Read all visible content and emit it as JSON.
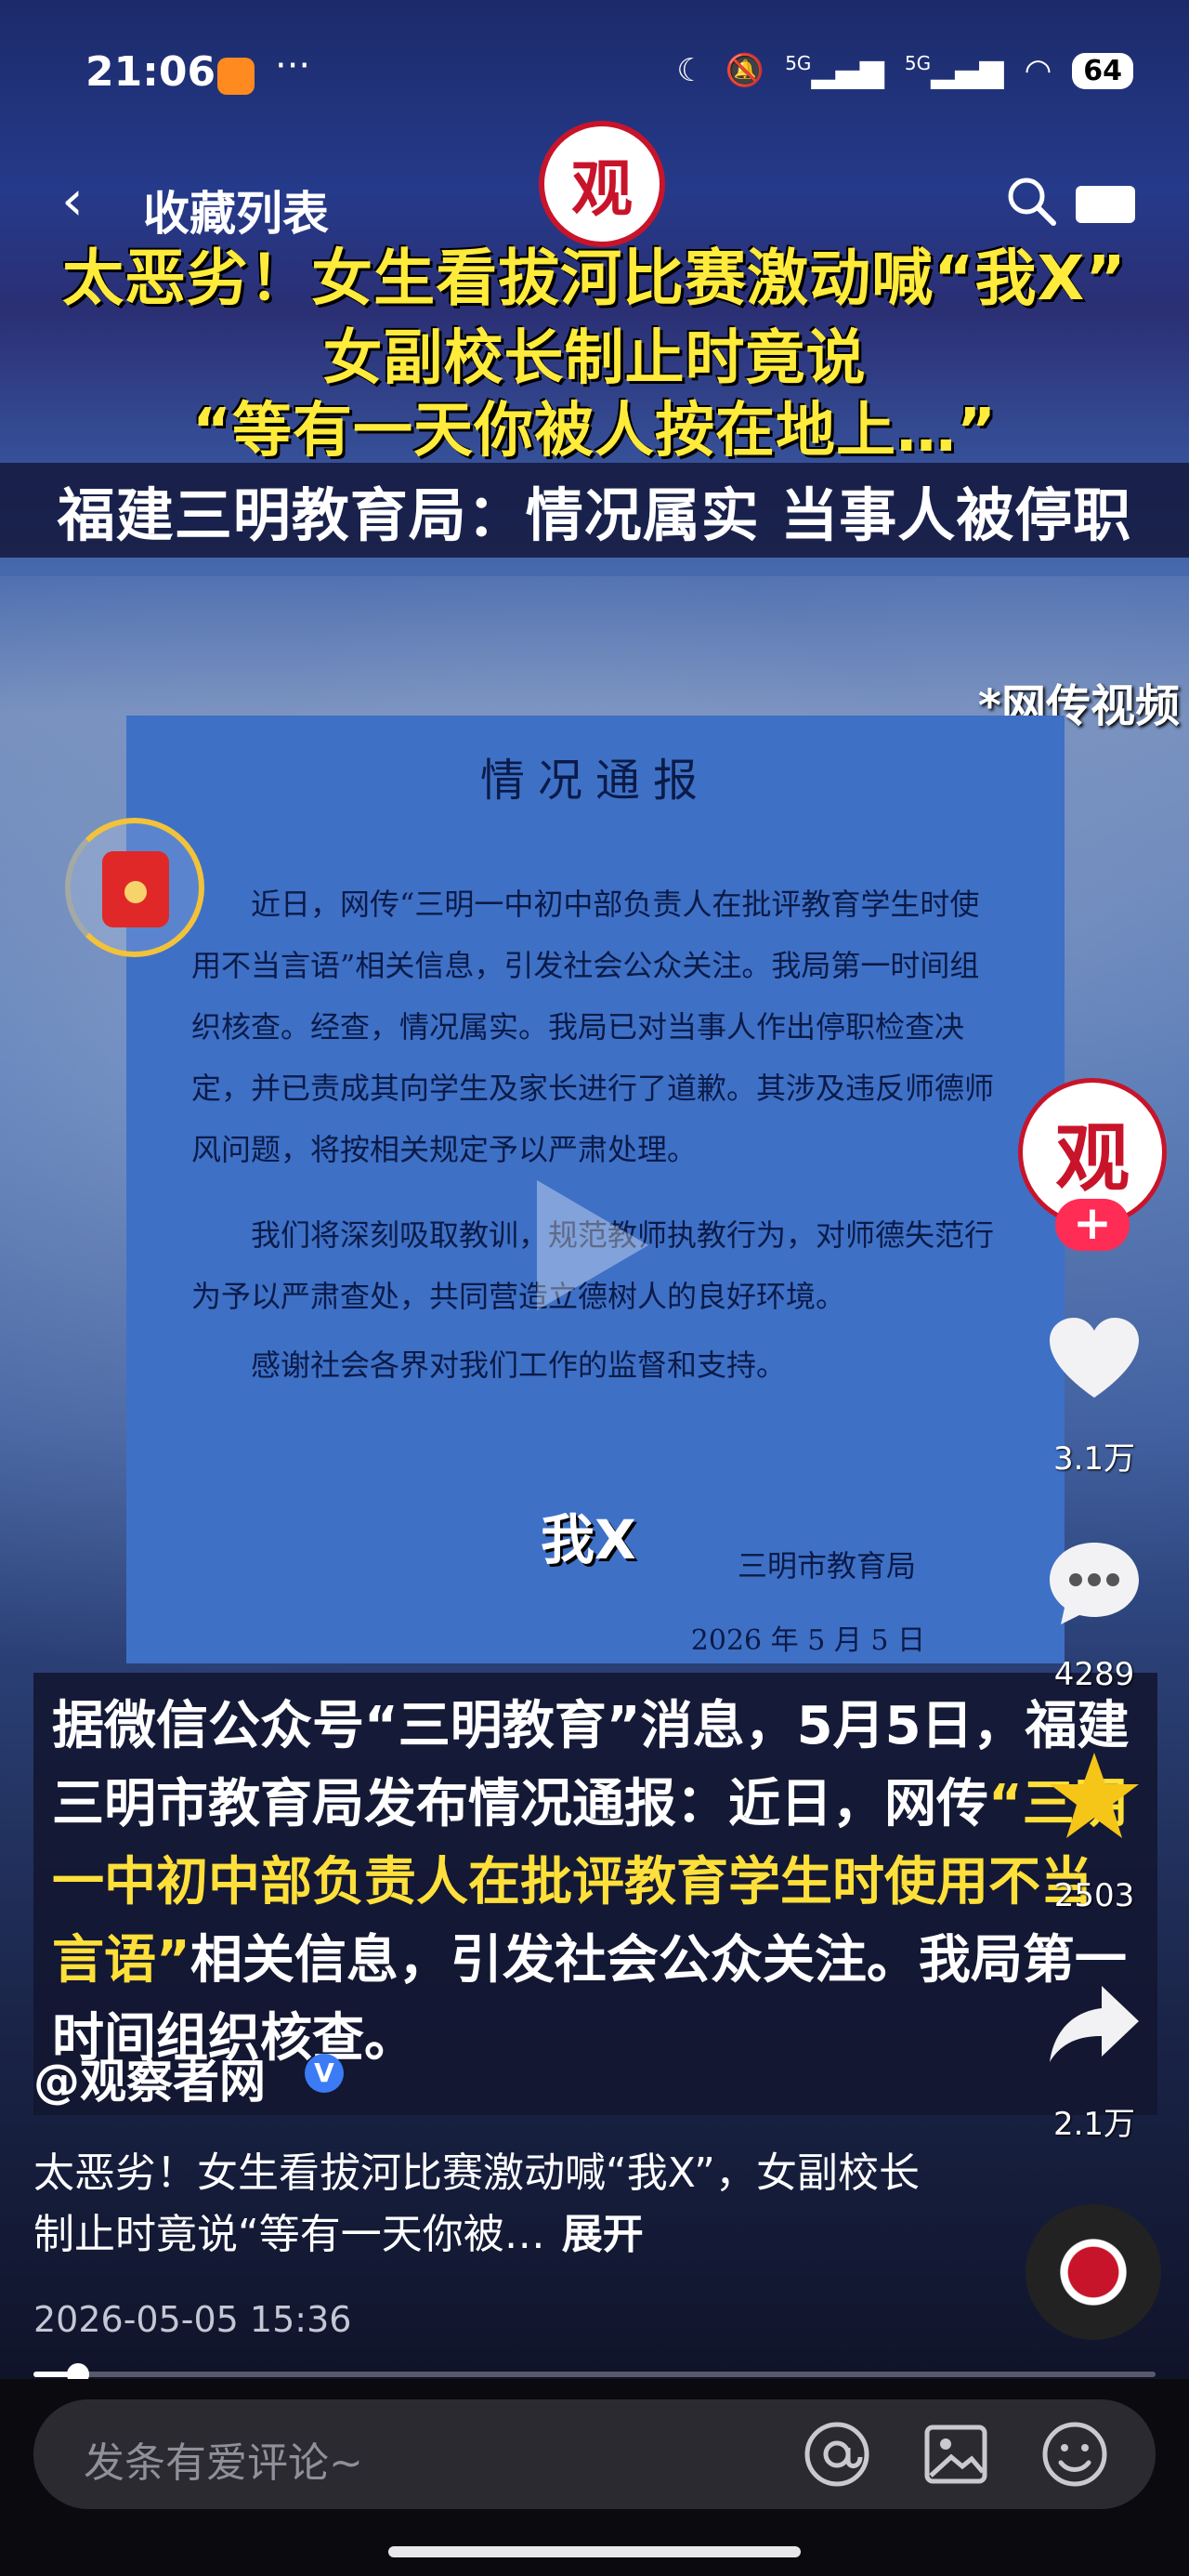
{
  "status_bar": {
    "time": "21:06",
    "dots": "···",
    "signal1": "5G",
    "signal2": "5G",
    "battery": "64"
  },
  "nav": {
    "back_icon": "chevron-left-icon",
    "title": "收藏列表",
    "search_icon": "search-icon",
    "share_icon": "share-icon"
  },
  "video": {
    "logo_text": "观",
    "headline": [
      "太恶劣！女生看拔河比赛激动喊“我X”",
      "女副校长制止时竟说",
      "“等有一天你被人按在地上…”",
      "福建三明教育局：情况属实 当事人被停职"
    ],
    "source_tag": "*网传视频",
    "notice": {
      "title": "情况通报",
      "paragraphs": [
        "近日，网传“三明一中初中部负责人在批评教育学生时使用不当言语”相关信息，引发社会公众关注。我局第一时间组织核查。经查，情况属实。我局已对当事人作出停职检查决定，并已责成其向学生及家长进行了道歉。其涉及违反师德师风问题，将按相关规定予以严肃处理。",
        "我们将深刻吸取教训，规范教师执教行为，对师德失范行为予以严肃查处，共同营造立德树人的良好环境。",
        "感谢社会各界对我们工作的监督和支持。"
      ],
      "signature": "三明市教育局",
      "date": "2026 年 5 月 5 日"
    },
    "overlay_word": "我X",
    "caption": {
      "part1": "据微信公众号“三明教育”消息，5月5日，福建三明市教育局发布情况通报：近日，网传",
      "highlight": "“三明一中初中部负责人在批评教育学生时使用不当言语”",
      "part2": "相关信息，引发社会公众关注。我局第一时间组织核查。"
    }
  },
  "rail": {
    "avatar_text": "观",
    "follow_label": "+",
    "like_count": "3.1万",
    "comment_count": "4289",
    "favorite_count": "2503",
    "share_count": "2.1万"
  },
  "post": {
    "author": "@观察者网",
    "verified": "V",
    "description": "太恶劣！女生看拔河比赛激动喊“我X”，女副校长制止时竟说“等有一天你被…",
    "expand_label": "展开",
    "timestamp": "2026-05-05 15:36",
    "progress": 0.04
  },
  "comment_bar": {
    "placeholder": "发条有爱评论~",
    "mention_icon": "at-icon",
    "image_icon": "image-icon",
    "emoji_icon": "emoji-icon"
  },
  "colors": {
    "accent_red": "#c8142a",
    "headline_yellow": "#ffeb3b",
    "favorite_gold": "#f5c518"
  }
}
